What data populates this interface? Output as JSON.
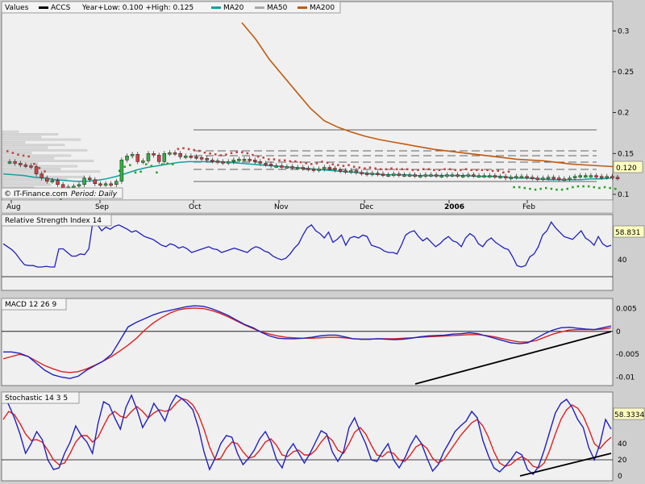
{
  "colors": {
    "bg": "#cfcfcf",
    "plot": "#f0f0f0",
    "ma20": "#10a0a0",
    "ma50": "#a8a8a8",
    "ma200": "#c05a10",
    "psar_top": "#c04040",
    "psar_bot": "#20a020",
    "price_up": "#30b040",
    "price_dn": "#d04040",
    "rsi": "#2020c0",
    "macd": "#2020c0",
    "signal": "#e02020",
    "stoch_k": "#2020c0",
    "stoch_d": "#e02020",
    "trend": "#000000",
    "last_box": "#ffffc0"
  },
  "price_panel": {
    "legend_values": "Values",
    "legend_ticker": "ACCS",
    "legend_range": "Year+Low: 0.100 +High: 0.125",
    "legend_ma20": "MA20",
    "legend_ma50": "MA50",
    "legend_ma200": "MA200",
    "credit": "© IT-Finance.com",
    "period": "Period: Daily",
    "last_value": "0.120",
    "y_ticks": [
      "0.1",
      "0.15",
      "0.2",
      "0.25",
      "0.3"
    ],
    "x_labels": [
      "Aug",
      "Sep",
      "Oct",
      "Nov",
      "Dec",
      "2006",
      "Feb"
    ]
  },
  "rsi_panel": {
    "title": "Relative Strength Index 14",
    "last_value": "58.831",
    "y_ticks": [
      "40"
    ]
  },
  "macd_panel": {
    "title": "MACD 12 26 9",
    "y_ticks": [
      "0.005",
      "0",
      "-0.005",
      "-0.01"
    ]
  },
  "stoch_panel": {
    "title": "Stochastic 14 3 5",
    "last_value": "58.3334",
    "y_ticks": [
      "0",
      "20",
      "40"
    ]
  },
  "chart_data": {
    "type": "line",
    "title": "ACCS",
    "x_range": [
      "Aug",
      "Feb"
    ],
    "price": {
      "ylim": [
        0.095,
        0.32
      ],
      "close": [
        0.14,
        0.138,
        0.136,
        0.135,
        0.134,
        0.125,
        0.12,
        0.116,
        0.117,
        0.112,
        0.108,
        0.109,
        0.11,
        0.112,
        0.12,
        0.118,
        0.113,
        0.112,
        0.113,
        0.112,
        0.116,
        0.142,
        0.147,
        0.149,
        0.14,
        0.141,
        0.15,
        0.148,
        0.14,
        0.15,
        0.151,
        0.15,
        0.146,
        0.147,
        0.146,
        0.145,
        0.144,
        0.142,
        0.141,
        0.14,
        0.139,
        0.14,
        0.142,
        0.143,
        0.143,
        0.142,
        0.14,
        0.138,
        0.137,
        0.135,
        0.135,
        0.134,
        0.134,
        0.133,
        0.133,
        0.132,
        0.131,
        0.13,
        0.131,
        0.133,
        0.132,
        0.13,
        0.129,
        0.128,
        0.129,
        0.127,
        0.126,
        0.125,
        0.126,
        0.125,
        0.124,
        0.124,
        0.125,
        0.124,
        0.124,
        0.124,
        0.123,
        0.123,
        0.124,
        0.124,
        0.123,
        0.123,
        0.124,
        0.124,
        0.123,
        0.123,
        0.124,
        0.123,
        0.123,
        0.123,
        0.123,
        0.122,
        0.122,
        0.12,
        0.121,
        0.122,
        0.122,
        0.121,
        0.12,
        0.119,
        0.12,
        0.121,
        0.12,
        0.119,
        0.119,
        0.12,
        0.122,
        0.123,
        0.123,
        0.123,
        0.122,
        0.121,
        0.122,
        0.121,
        0.12
      ],
      "ma20": [
        0.125,
        0.124,
        0.123,
        0.121,
        0.12,
        0.118,
        0.117,
        0.116,
        0.116,
        0.117,
        0.119,
        0.122,
        0.126,
        0.13,
        0.133,
        0.135,
        0.137,
        0.139,
        0.14,
        0.14,
        0.14,
        0.14,
        0.139,
        0.138,
        0.137,
        0.136,
        0.135,
        0.134,
        0.133,
        0.132,
        0.131,
        0.13,
        0.129,
        0.128,
        0.127,
        0.126,
        0.125,
        0.124,
        0.124,
        0.124,
        0.123,
        0.123,
        0.123,
        0.123,
        0.123,
        0.123,
        0.122,
        0.122,
        0.122,
        0.121,
        0.12,
        0.12,
        0.119,
        0.118,
        0.118,
        0.118,
        0.118,
        0.119,
        0.119,
        0.12
      ],
      "ma200": [
        null,
        null,
        null,
        null,
        null,
        null,
        null,
        null,
        null,
        null,
        null,
        null,
        0.31,
        0.29,
        0.265,
        0.245,
        0.225,
        0.205,
        0.19,
        0.182,
        0.176,
        0.171,
        0.167,
        0.164,
        0.161,
        0.158,
        0.155,
        0.153,
        0.151,
        0.149,
        0.147,
        0.145,
        0.143,
        0.142,
        0.141,
        0.139,
        0.137,
        0.136,
        0.135,
        0.134
      ]
    },
    "rsi": {
      "ylim": [
        0,
        100
      ],
      "values": [
        62,
        58,
        54,
        48,
        40,
        33,
        32,
        32,
        30,
        30,
        31,
        30,
        30,
        55,
        55,
        50,
        45,
        45,
        48,
        47,
        55,
        95,
        88,
        80,
        85,
        82,
        86,
        88,
        85,
        82,
        78,
        80,
        76,
        72,
        70,
        68,
        64,
        60,
        58,
        62,
        60,
        56,
        58,
        55,
        50,
        52,
        54,
        56,
        58,
        55,
        54,
        50,
        52,
        54,
        56,
        54,
        52,
        50,
        55,
        58,
        56,
        52,
        50,
        45,
        42,
        40,
        42,
        48,
        56,
        62,
        74,
        84,
        88,
        80,
        76,
        70,
        78,
        64,
        68,
        74,
        60,
        70,
        72,
        70,
        74,
        72,
        60,
        58,
        56,
        52,
        50,
        50,
        48,
        60,
        74,
        78,
        80,
        72,
        66,
        70,
        64,
        58,
        62,
        68,
        72,
        66,
        64,
        58,
        70,
        76,
        72,
        62,
        58,
        66,
        70,
        64,
        60,
        56,
        54,
        44,
        32,
        30,
        32,
        44,
        48,
        58,
        74,
        80,
        92,
        84,
        78,
        72,
        70,
        68,
        74,
        80,
        70,
        66,
        60,
        72,
        62,
        58,
        60
      ],
      "ref_line": 30
    },
    "macd": {
      "ylim": [
        -0.0115,
        0.0065
      ],
      "macd": [
        -0.0045,
        -0.0045,
        -0.0048,
        -0.0055,
        -0.007,
        -0.0085,
        -0.0095,
        -0.01,
        -0.0103,
        -0.0098,
        -0.0085,
        -0.0075,
        -0.0065,
        -0.005,
        -0.002,
        0.001,
        0.002,
        0.0028,
        0.0036,
        0.0042,
        0.0046,
        0.005,
        0.0054,
        0.0056,
        0.0055,
        0.005,
        0.0043,
        0.0035,
        0.0025,
        0.0015,
        0.0008,
        -0.0002,
        -0.001,
        -0.0015,
        -0.0016,
        -0.0016,
        -0.0015,
        -0.0013,
        -0.001,
        -0.0008,
        -0.0008,
        -0.0012,
        -0.0016,
        -0.0017,
        -0.0017,
        -0.0016,
        -0.0017,
        -0.0018,
        -0.0017,
        -0.0015,
        -0.0012,
        -0.001,
        -0.0009,
        -0.0008,
        -0.0006,
        -0.0005,
        -0.0003,
        -0.0005,
        -0.001,
        -0.0015,
        -0.002,
        -0.0025,
        -0.0027,
        -0.0025,
        -0.0015,
        -0.0005,
        0.0003,
        0.0008,
        0.0009,
        0.0007,
        0.0005,
        0.0004,
        0.0008,
        0.0012
      ],
      "signal": [
        -0.006,
        -0.0055,
        -0.005,
        -0.0055,
        -0.0065,
        -0.0075,
        -0.0082,
        -0.0088,
        -0.009,
        -0.0088,
        -0.0082,
        -0.0074,
        -0.0065,
        -0.0055,
        -0.0043,
        -0.003,
        -0.0015,
        0.0003,
        0.0018,
        0.003,
        0.004,
        0.0047,
        0.005,
        0.0051,
        0.005,
        0.0046,
        0.004,
        0.0032,
        0.0023,
        0.0014,
        0.0006,
        -0.0001,
        -0.0006,
        -0.001,
        -0.0013,
        -0.0014,
        -0.0015,
        -0.0015,
        -0.0014,
        -0.0013,
        -0.0013,
        -0.0014,
        -0.0016,
        -0.0017,
        -0.0017,
        -0.0016,
        -0.0016,
        -0.0016,
        -0.0015,
        -0.0014,
        -0.0013,
        -0.0012,
        -0.0011,
        -0.001,
        -0.0009,
        -0.0008,
        -0.0007,
        -0.0007,
        -0.0009,
        -0.0012,
        -0.0016,
        -0.002,
        -0.0023,
        -0.0023,
        -0.002,
        -0.0013,
        -0.0006,
        -0.0001,
        0.0003,
        0.0004,
        0.0004,
        0.0004,
        0.0005,
        0.0008
      ]
    },
    "stoch": {
      "ylim": [
        0,
        100
      ],
      "k": [
        100,
        88,
        72,
        52,
        28,
        40,
        55,
        45,
        20,
        8,
        10,
        28,
        42,
        62,
        50,
        42,
        28,
        65,
        92,
        88,
        72,
        58,
        85,
        100,
        82,
        60,
        72,
        90,
        80,
        68,
        88,
        100,
        96,
        90,
        82,
        60,
        30,
        8,
        22,
        40,
        50,
        48,
        28,
        14,
        22,
        32,
        46,
        55,
        42,
        20,
        10,
        30,
        40,
        28,
        16,
        28,
        42,
        56,
        52,
        30,
        18,
        30,
        60,
        72,
        55,
        40,
        20,
        18,
        30,
        40,
        20,
        10,
        22,
        38,
        50,
        40,
        22,
        6,
        14,
        30,
        42,
        55,
        62,
        68,
        80,
        72,
        44,
        25,
        10,
        5,
        12,
        20,
        30,
        26,
        8,
        2,
        12,
        32,
        55,
        78,
        90,
        95,
        85,
        70,
        60,
        35,
        20,
        40,
        70,
        58
      ],
      "d": [
        70,
        80,
        76,
        65,
        52,
        44,
        45,
        42,
        32,
        20,
        14,
        16,
        28,
        42,
        50,
        50,
        42,
        48,
        62,
        75,
        80,
        74,
        72,
        80,
        86,
        80,
        72,
        78,
        82,
        80,
        82,
        90,
        96,
        94,
        88,
        76,
        58,
        36,
        20,
        22,
        34,
        42,
        40,
        30,
        22,
        24,
        32,
        42,
        46,
        38,
        26,
        24,
        30,
        32,
        26,
        26,
        32,
        42,
        50,
        44,
        32,
        28,
        40,
        54,
        60,
        52,
        38,
        26,
        24,
        30,
        28,
        20,
        18,
        26,
        36,
        40,
        34,
        22,
        16,
        20,
        30,
        40,
        50,
        58,
        66,
        70,
        62,
        48,
        30,
        16,
        12,
        14,
        20,
        24,
        20,
        12,
        10,
        16,
        32,
        52,
        70,
        82,
        88,
        84,
        74,
        58,
        40,
        34,
        42,
        48
      ],
      "ref_lines": [
        20
      ]
    }
  }
}
